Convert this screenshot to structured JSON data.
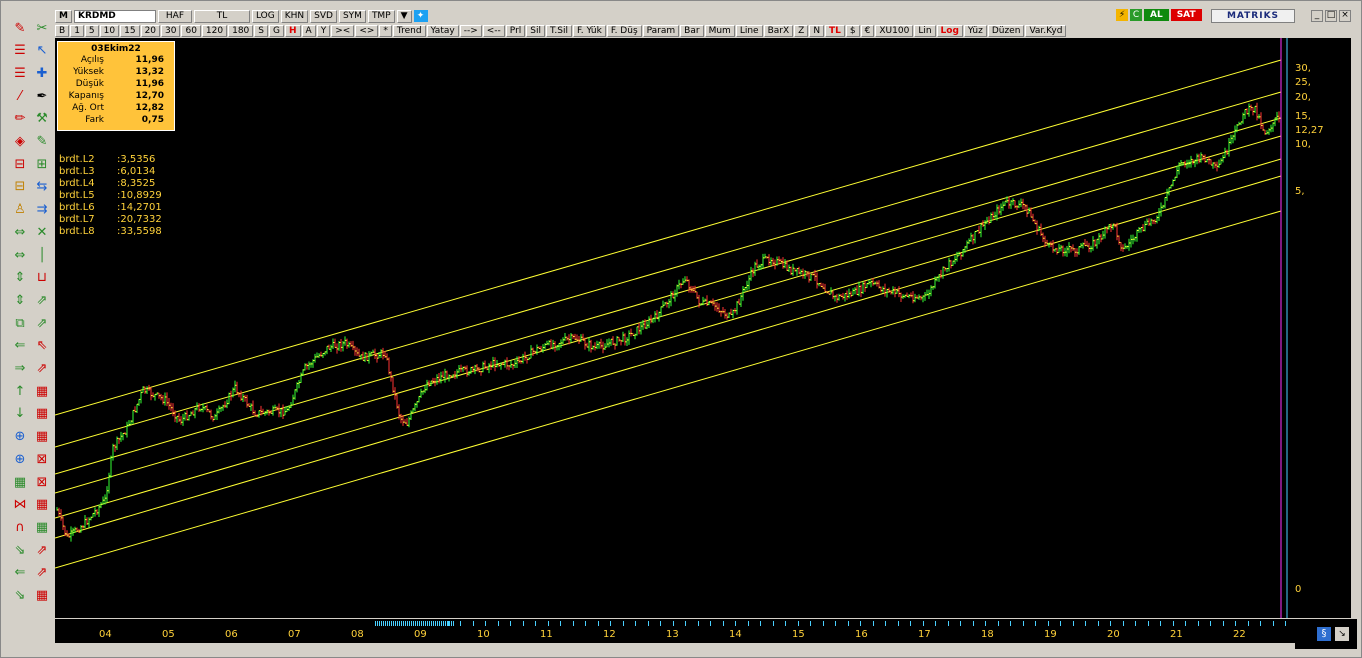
{
  "toolbar1": {
    "m_label": "M",
    "symbol": "KRDMD",
    "period": "HAF",
    "currency": "TL",
    "log": "LOG",
    "khn": "KHN",
    "svd": "SVD",
    "sym": "SYM",
    "tmp": "TMP",
    "al": "AL",
    "sat": "SAT",
    "brand": "MATRIKS"
  },
  "toolbar2": {
    "buttons": [
      "B",
      "1",
      "5",
      "10",
      "15",
      "20",
      "30",
      "60",
      "120",
      "180",
      "S",
      "G",
      "H",
      "A",
      "Y",
      "><",
      "<>",
      "*",
      "Trend",
      "Yatay",
      "-->",
      "<--",
      "Prl",
      "Sil",
      "T.Sil",
      "F. Yük",
      "F. Düş",
      "Param",
      "Bar",
      "Mum",
      "Line",
      "BarX",
      "Z",
      "N",
      "TL",
      "$",
      "€",
      "XU100",
      "Lin",
      "Log",
      "Yüz",
      "Düzen",
      "Var.Kyd"
    ]
  },
  "info": {
    "date": "03Ekim22",
    "rows": [
      {
        "k": "Açılış",
        "v": "11,96"
      },
      {
        "k": "Yüksek",
        "v": "13,32"
      },
      {
        "k": "Düşük",
        "v": "11,96"
      },
      {
        "k": "Kapanış",
        "v": "12,70"
      },
      {
        "k": "Ağ. Ort",
        "v": "12,82"
      },
      {
        "k": "Fark",
        "v": "0,75"
      }
    ]
  },
  "levels": [
    {
      "k": "brdt.L2",
      "v": ":3,5356"
    },
    {
      "k": "brdt.L3",
      "v": ":6,0134"
    },
    {
      "k": "brdt.L4",
      "v": ":8,3525"
    },
    {
      "k": "brdt.L5",
      "v": ":10,8929"
    },
    {
      "k": "brdt.L6",
      "v": ":14,2701"
    },
    {
      "k": "brdt.L7",
      "v": ":20,7332"
    },
    {
      "k": "brdt.L8",
      "v": ":33,5598"
    }
  ],
  "y_axis": [
    "30,",
    "25,",
    "20,",
    "15,",
    "12,27",
    "10,",
    "5,",
    "0"
  ],
  "x_axis": [
    "04",
    "05",
    "06",
    "07",
    "08",
    "09",
    "10",
    "11",
    "12",
    "13",
    "14",
    "15",
    "16",
    "17",
    "18",
    "19",
    "20",
    "21",
    "22"
  ],
  "colors": {
    "chart_bg": "#000000",
    "channel": "#ffff33",
    "up": "#33ff33",
    "down": "#ff3333",
    "label": "#ffd23a"
  }
}
